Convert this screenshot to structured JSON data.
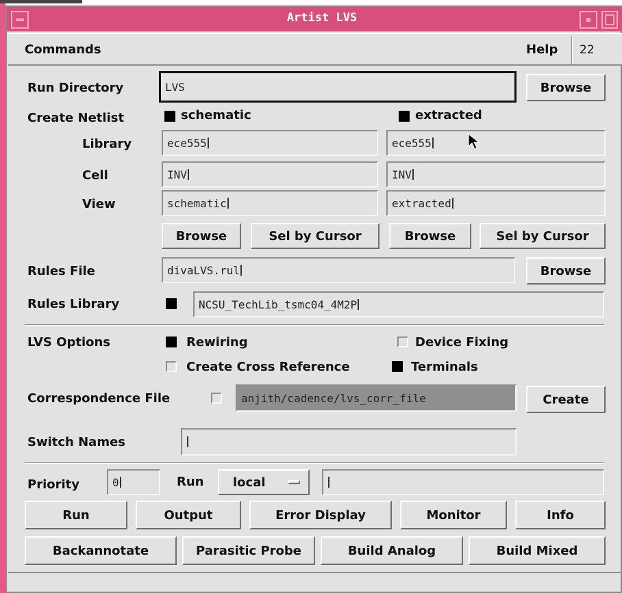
{
  "window": {
    "title": "Artist LVS"
  },
  "menu": {
    "commands": "Commands",
    "help": "Help",
    "number": "22"
  },
  "run_directory": {
    "label": "Run Directory",
    "value": "LVS",
    "browse": "Browse"
  },
  "create_netlist": {
    "label": "Create Netlist",
    "schematic": {
      "label": "schematic",
      "checked": true,
      "library": "ece555",
      "cell": "INV",
      "view": "schematic"
    },
    "extracted": {
      "label": "extracted",
      "checked": true,
      "library": "ece555",
      "cell": "INV",
      "view": "extracted"
    },
    "library_label": "Library",
    "cell_label": "Cell",
    "view_label": "View",
    "browse": "Browse",
    "sel_by_cursor": "Sel by Cursor"
  },
  "rules_file": {
    "label": "Rules File",
    "value": "divaLVS.rul",
    "browse": "Browse"
  },
  "rules_library": {
    "label": "Rules Library",
    "checked": true,
    "value": "NCSU_TechLib_tsmc04_4M2P"
  },
  "lvs_options": {
    "label": "LVS Options",
    "rewiring": {
      "label": "Rewiring",
      "checked": true
    },
    "device_fixing": {
      "label": "Device Fixing",
      "checked": false
    },
    "cross_reference": {
      "label": "Create Cross Reference",
      "checked": false
    },
    "terminals": {
      "label": "Terminals",
      "checked": true
    }
  },
  "correspondence": {
    "label": "Correspondence File",
    "checked": false,
    "value": "anjith/cadence/lvs_corr_file",
    "create": "Create"
  },
  "switch_names": {
    "label": "Switch Names",
    "value": ""
  },
  "priority": {
    "label": "Priority",
    "value": "0",
    "run_label": "Run",
    "run_mode": "local",
    "run_value": ""
  },
  "buttons_row1": [
    "Run",
    "Output",
    "Error Display",
    "Monitor",
    "Info"
  ],
  "buttons_row2": [
    "Backannotate",
    "Parasitic Probe",
    "Build Analog",
    "Build Mixed"
  ],
  "colors": {
    "titlebar": "#d84f7c",
    "background": "#e2e2e2",
    "disabled_field": "#8f8f8f"
  }
}
